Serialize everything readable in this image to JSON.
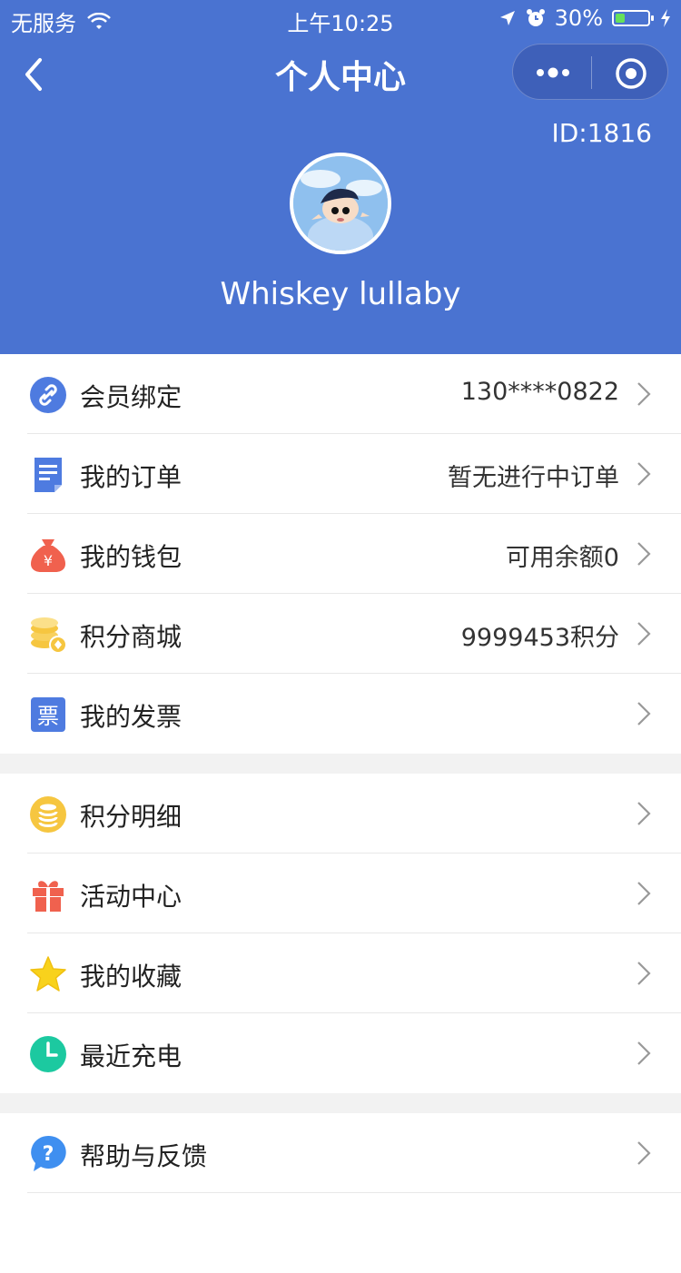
{
  "status_bar": {
    "carrier": "无服务",
    "time": "上午10:25",
    "battery_percent": "30%",
    "battery_level": 0.3
  },
  "nav": {
    "title": "个人中心"
  },
  "profile": {
    "id_label": "ID:1816",
    "username": "Whiskey lullaby"
  },
  "menu_group_1": [
    {
      "label": "会员绑定",
      "value": "130****0822"
    },
    {
      "label": "我的订单",
      "value": "暂无进行中订单"
    },
    {
      "label": "我的钱包",
      "value": "可用余额0"
    },
    {
      "label": "积分商城",
      "value": "9999453积分"
    },
    {
      "label": "我的发票",
      "value": ""
    }
  ],
  "menu_group_2": [
    {
      "label": "积分明细"
    },
    {
      "label": "活动中心"
    },
    {
      "label": "我的收藏"
    },
    {
      "label": "最近充电"
    }
  ],
  "menu_group_3": [
    {
      "label": "帮助与反馈"
    }
  ],
  "colors": {
    "header_bg": "#4a73d1",
    "link_icon": "#4e7be0",
    "order_icon": "#4e7be0",
    "wallet_icon": "#f0614e",
    "coins_icon": "#f6c640",
    "invoice_icon": "#4e7be0",
    "points_icon": "#f6c640",
    "gift_icon": "#f0614e",
    "star_icon": "#f8d21c",
    "clock_icon": "#1cc9a0",
    "help_icon": "#3f8ff0"
  },
  "icons": {
    "invoice_char": "票"
  }
}
